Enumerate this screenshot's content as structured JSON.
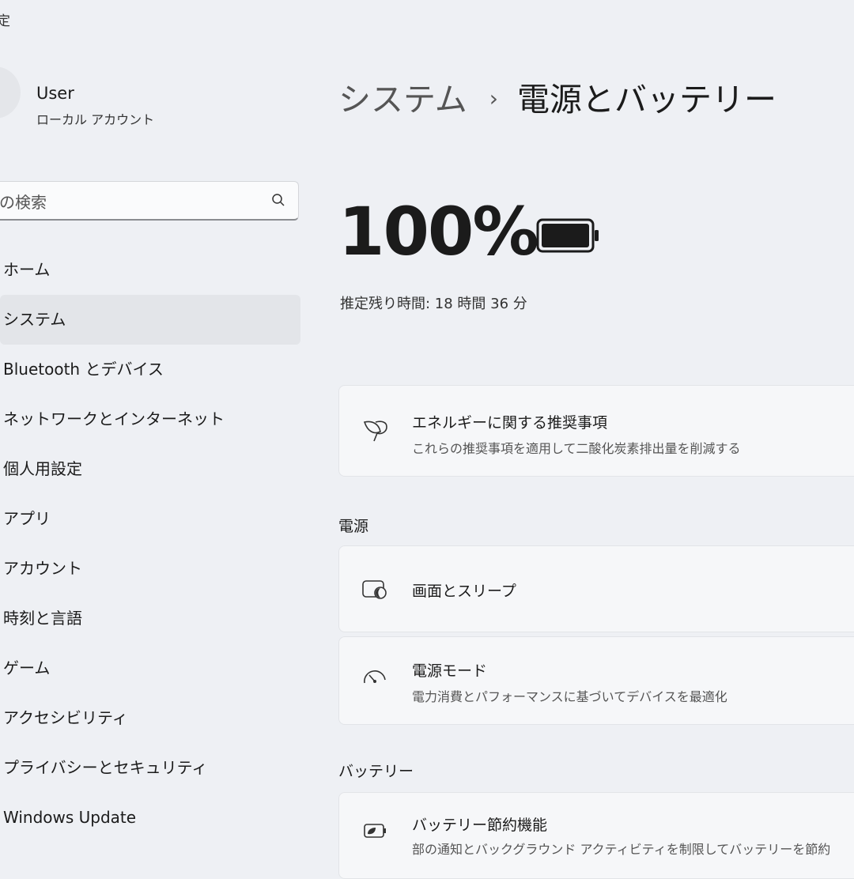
{
  "window": {
    "title": "定"
  },
  "user": {
    "name": "User",
    "account_type": "ローカル アカウント"
  },
  "search": {
    "placeholder": "の検索"
  },
  "sidebar": {
    "items": [
      {
        "label": "ホーム"
      },
      {
        "label": "システム",
        "selected": true
      },
      {
        "label": "Bluetooth とデバイス"
      },
      {
        "label": "ネットワークとインターネット"
      },
      {
        "label": "個人用設定"
      },
      {
        "label": "アプリ"
      },
      {
        "label": "アカウント"
      },
      {
        "label": "時刻と言語"
      },
      {
        "label": "ゲーム"
      },
      {
        "label": "アクセシビリティ"
      },
      {
        "label": "プライバシーとセキュリティ"
      },
      {
        "label": "Windows Update"
      }
    ]
  },
  "breadcrumb": {
    "parent": "システム",
    "separator": "›",
    "current": "電源とバッテリー"
  },
  "battery": {
    "percent_text": "100%",
    "level": 1.0,
    "remaining": "推定残り時間: 18 時間 36 分"
  },
  "energy_card": {
    "title": "エネルギーに関する推奨事項",
    "description": "これらの推奨事項を適用して二酸化炭素排出量を削減する",
    "icon": "leaf-icon"
  },
  "power_section": {
    "header": "電源",
    "items": [
      {
        "title": "画面とスリープ",
        "icon": "screen-sleep-icon"
      },
      {
        "title": "電源モード",
        "description": "電力消費とパフォーマンスに基づいてデバイスを最適化",
        "icon": "gauge-icon"
      }
    ]
  },
  "battery_section": {
    "header": "バッテリー",
    "items": [
      {
        "title": "バッテリー節約機能",
        "description": "部の通知とバックグラウンド アクティビティを制限してバッテリーを節約",
        "icon": "battery-saver-icon"
      }
    ]
  },
  "colors": {
    "background": "#eef0f4",
    "card": "#f6f7f9",
    "selected": "#e3e5e9"
  }
}
